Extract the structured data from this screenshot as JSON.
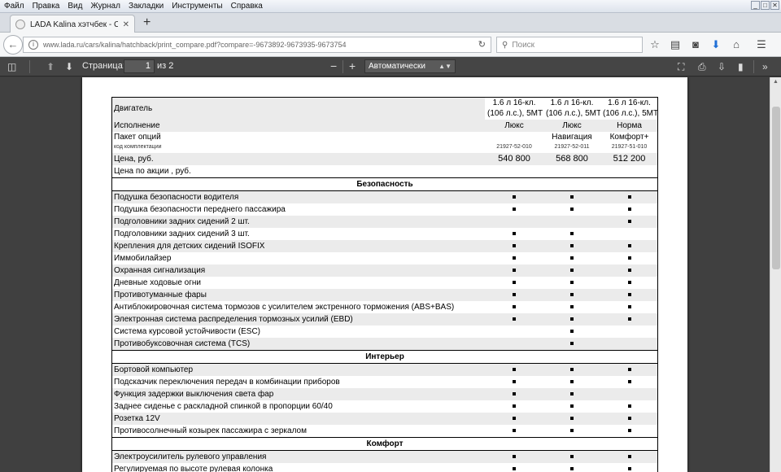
{
  "menu": [
    "Файл",
    "Правка",
    "Вид",
    "Журнал",
    "Закладки",
    "Инструменты",
    "Справка"
  ],
  "tab": {
    "title": "LADA Kalina хэтчбек - Сравн...",
    "close": "✕"
  },
  "newtab": "+",
  "nav": {
    "url": "www.lada.ru/cars/kalina/hatchback/print_compare.pdf?compare=-9673892-9673935-9673754",
    "search_placeholder": "Поиск"
  },
  "pdf": {
    "page_label": "Страница:",
    "page_value": "1",
    "of_label": "из 2",
    "zoom": "Автоматически"
  },
  "columns": [
    {
      "engine": "1.6 л 16-кл.",
      "engine2": "(106 л.с.), 5МТ",
      "trim": "Люкс",
      "option_name": "",
      "option_code": "21927-52-010",
      "price": "540 800"
    },
    {
      "engine": "1.6 л 16-кл.",
      "engine2": "(106 л.с.), 5МТ",
      "trim": "Люкс",
      "option_name": "Навигация",
      "option_code": "21927-52-011",
      "price": "568 800"
    },
    {
      "engine": "1.6 л 16-кл.",
      "engine2": "(106 л.с.), 5МТ",
      "trim": "Норма",
      "option_name": "Комфорт+",
      "option_code": "21927-51-010",
      "price": "512 200"
    }
  ],
  "rowlabels": {
    "engine": "Двигатель",
    "trim": "Исполнение",
    "options": "Пакет опций",
    "options_sub": "код комплектации",
    "price": "Цена, руб.",
    "promo": "Цена по акции , руб."
  },
  "sections": [
    {
      "title": "Безопасность",
      "rows": [
        {
          "label": "Подушка безопасности водителя",
          "v": [
            1,
            1,
            1
          ]
        },
        {
          "label": "Подушка безопасности переднего пассажира",
          "v": [
            1,
            1,
            1
          ]
        },
        {
          "label": "Подголовники задних сидений 2 шт.",
          "v": [
            0,
            0,
            1
          ]
        },
        {
          "label": "Подголовники задних сидений 3 шт.",
          "v": [
            1,
            1,
            0
          ]
        },
        {
          "label": "Крепления для детских сидений ISOFIX",
          "v": [
            1,
            1,
            1
          ]
        },
        {
          "label": "Иммобилайзер",
          "v": [
            1,
            1,
            1
          ]
        },
        {
          "label": "Охранная сигнализация",
          "v": [
            1,
            1,
            1
          ]
        },
        {
          "label": "Дневные ходовые огни",
          "v": [
            1,
            1,
            1
          ]
        },
        {
          "label": "Противотуманные фары",
          "v": [
            1,
            1,
            1
          ]
        },
        {
          "label": "Антиблокировочная система тормозов с усилителем экстренного торможения (ABS+BAS)",
          "v": [
            1,
            1,
            1
          ]
        },
        {
          "label": "Электронная система распределения тормозных усилий (EBD)",
          "v": [
            1,
            1,
            1
          ]
        },
        {
          "label": "Система курсовой устойчивости (ESC)",
          "v": [
            0,
            1,
            0
          ]
        },
        {
          "label": "Противобуксовочная система (TCS)",
          "v": [
            0,
            1,
            0
          ]
        }
      ]
    },
    {
      "title": "Интерьер",
      "rows": [
        {
          "label": "Бортовой компьютер",
          "v": [
            1,
            1,
            1
          ]
        },
        {
          "label": "Подсказчик переключения передач в комбинации приборов",
          "v": [
            1,
            1,
            1
          ]
        },
        {
          "label": "Функция задержки выключения света фар",
          "v": [
            1,
            1,
            0
          ]
        },
        {
          "label": "Заднее сиденье с раскладной спинкой в пропорции 60/40",
          "v": [
            1,
            1,
            1
          ]
        },
        {
          "label": "Розетка 12V",
          "v": [
            1,
            1,
            1
          ]
        },
        {
          "label": "Противосолнечный козырек пассажира с зеркалом",
          "v": [
            1,
            1,
            1
          ]
        }
      ]
    },
    {
      "title": "Комфорт",
      "rows": [
        {
          "label": "Электроусилитель рулевого управления",
          "v": [
            1,
            1,
            1
          ]
        },
        {
          "label": "Регулируемая по высоте рулевая колонка",
          "v": [
            1,
            1,
            1
          ]
        }
      ]
    }
  ]
}
